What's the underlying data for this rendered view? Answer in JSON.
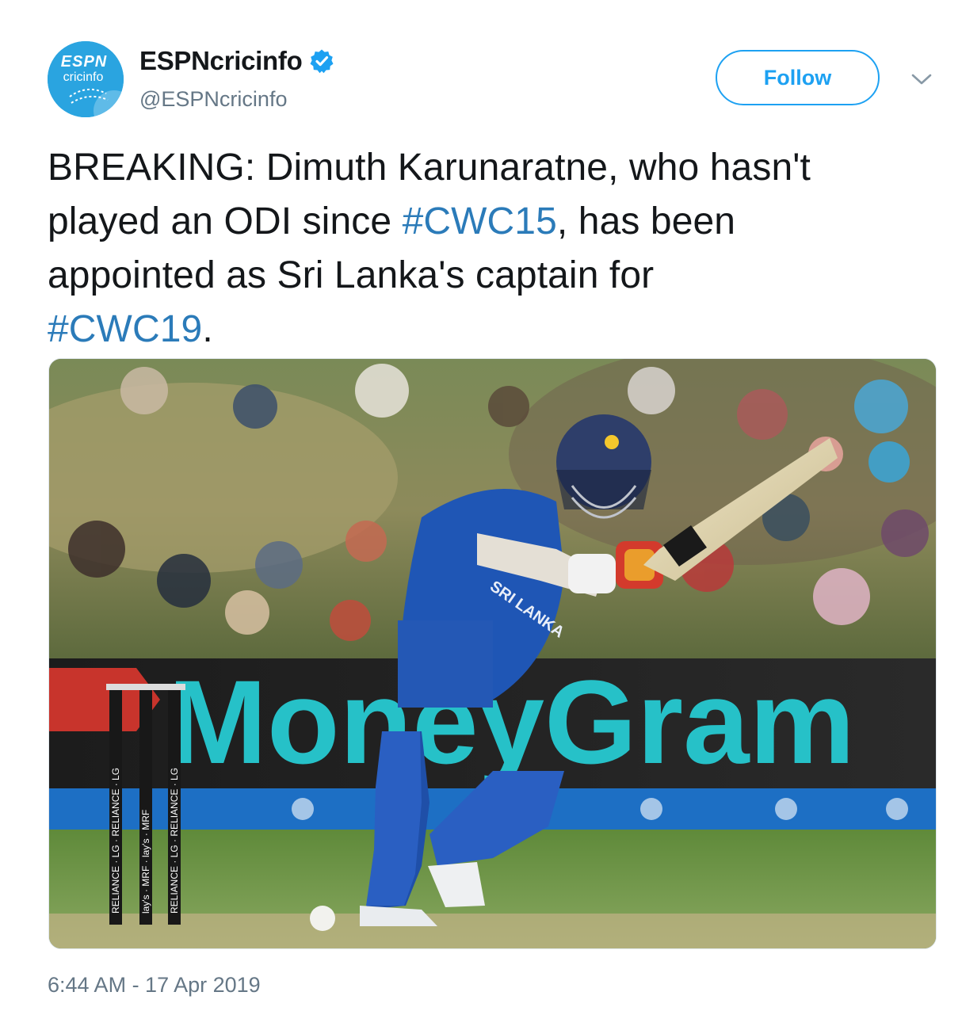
{
  "account": {
    "display_name": "ESPNcricinfo",
    "handle": "@ESPNcricinfo",
    "verified": true,
    "avatar_logo_lines": [
      "ESPN",
      "cricinfo"
    ]
  },
  "actions": {
    "follow_label": "Follow",
    "more_icon": "chevron-down-icon"
  },
  "tweet": {
    "text_lines": [
      [
        {
          "t": "BREAKING: Dimuth Karunaratne, who hasn't",
          "tag": false
        }
      ],
      [
        {
          "t": "played an ODI since ",
          "tag": false
        },
        {
          "t": "#CWC15",
          "tag": true
        },
        {
          "t": ", has been",
          "tag": false
        }
      ],
      [
        {
          "t": "appointed as Sri Lanka's captain for",
          "tag": false
        }
      ],
      [
        {
          "t": "#CWC19",
          "tag": true
        },
        {
          "t": ".",
          "tag": false
        }
      ]
    ],
    "timestamp": "6:44 AM - 17 Apr 2019"
  },
  "media": {
    "board_text": "MoneyGram",
    "shirt_text": "SRI LANKA",
    "stump_ads": [
      "RELIANCE",
      "LG",
      "lay's",
      "MRF"
    ]
  },
  "colors": {
    "accent": "#1da1f2",
    "hashtag": "#2b7bb9",
    "muted": "#657786",
    "text": "#14171a",
    "verified": "#1da1f2"
  }
}
